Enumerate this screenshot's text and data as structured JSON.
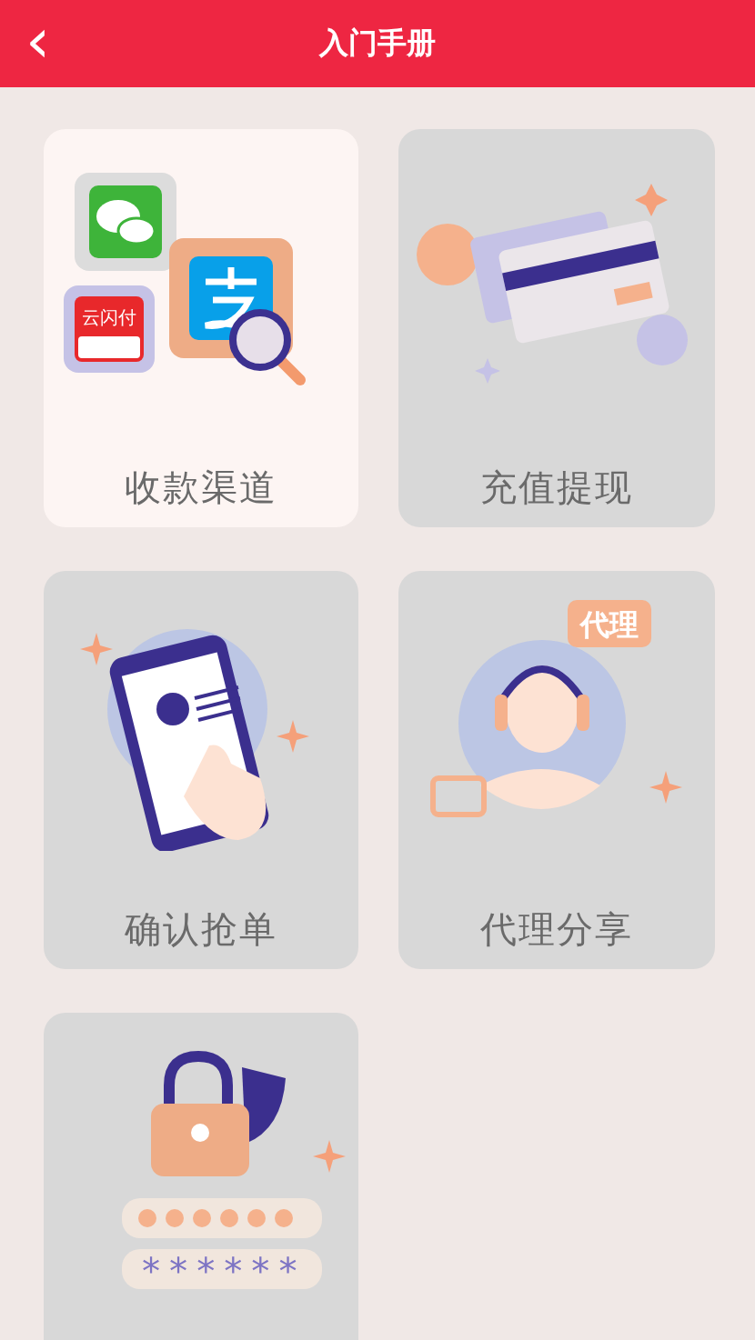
{
  "header": {
    "back_icon": "‹",
    "title": "入门手册"
  },
  "cards": [
    {
      "kind": "payment",
      "label": "收款渠道",
      "selected": true,
      "logo_text": "云闪付"
    },
    {
      "kind": "recharge",
      "label": "充值提现",
      "selected": false
    },
    {
      "kind": "phone",
      "label": "确认抢单",
      "selected": false
    },
    {
      "kind": "agent",
      "label": "代理分享",
      "selected": false,
      "badge": "代理"
    },
    {
      "kind": "security",
      "selected": false,
      "mask_text": "******"
    }
  ]
}
